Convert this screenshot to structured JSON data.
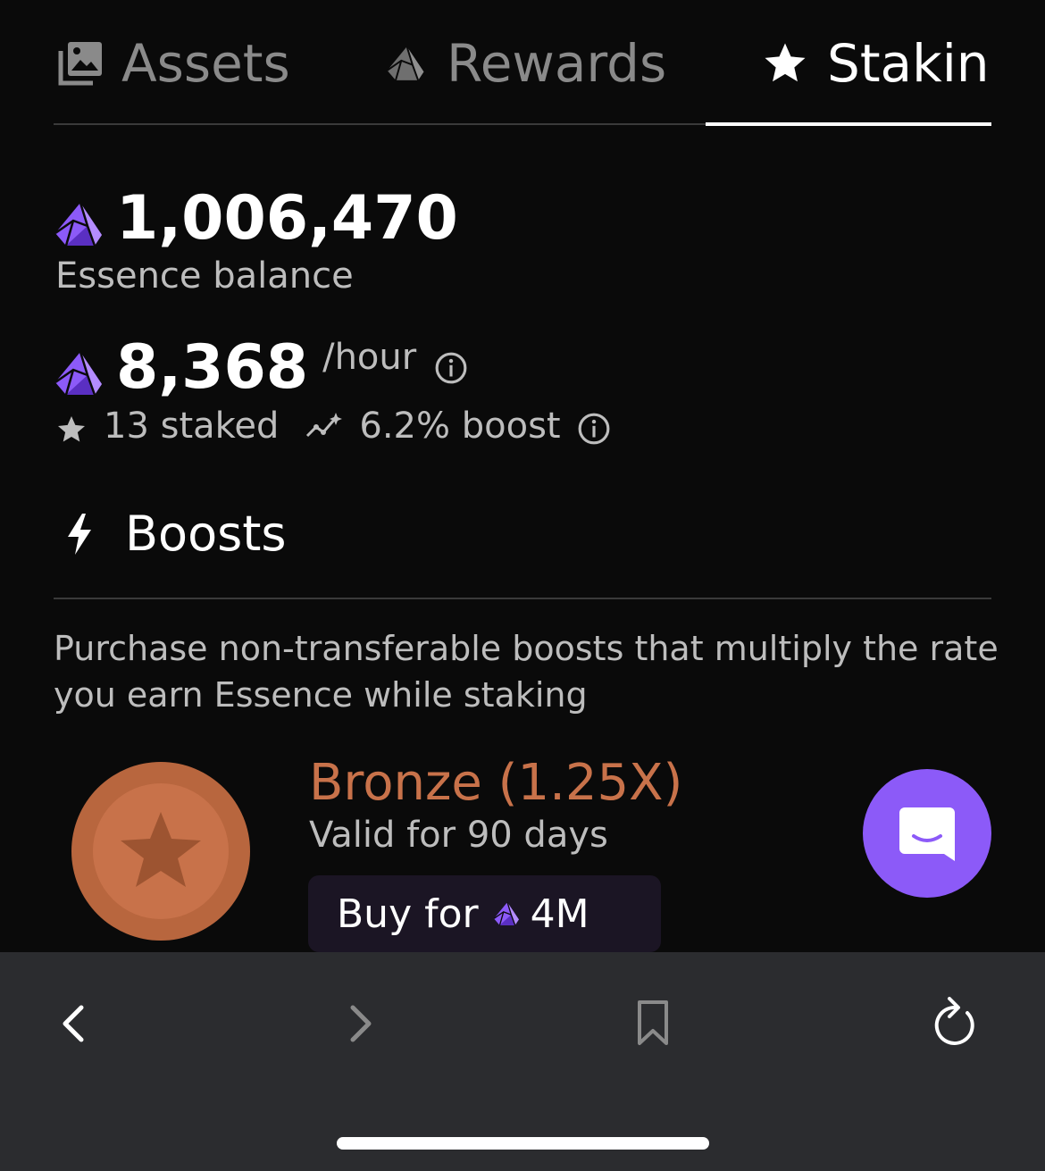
{
  "tabs": [
    {
      "label": "Assets",
      "icon": "image-gallery-icon",
      "active": false
    },
    {
      "label": "Rewards",
      "icon": "essence-gem-icon",
      "active": false
    },
    {
      "label": "Staking",
      "icon": "star-icon",
      "active": true
    }
  ],
  "balance": {
    "value": "1,006,470",
    "label": "Essence balance"
  },
  "rate": {
    "value": "8,368",
    "unit": "/hour",
    "staked": "13 staked",
    "boost": "6.2% boost"
  },
  "boosts": {
    "title": "Boosts",
    "description": "Purchase non-transferable boosts that multiply the rate you earn Essence while staking",
    "items": [
      {
        "name": "Bronze (1.25X)",
        "validity": "Valid for 90 days",
        "buy_label": "Buy for",
        "price": "4M",
        "color": "#c8724a"
      }
    ]
  },
  "colors": {
    "background": "#0a0a0a",
    "gem_purple": "#8c5af8",
    "bronze": "#c8724a",
    "browser_bar": "#2b2c2f"
  },
  "browser": {
    "buttons": [
      "back-icon",
      "forward-icon",
      "bookmark-icon",
      "reload-icon"
    ]
  }
}
